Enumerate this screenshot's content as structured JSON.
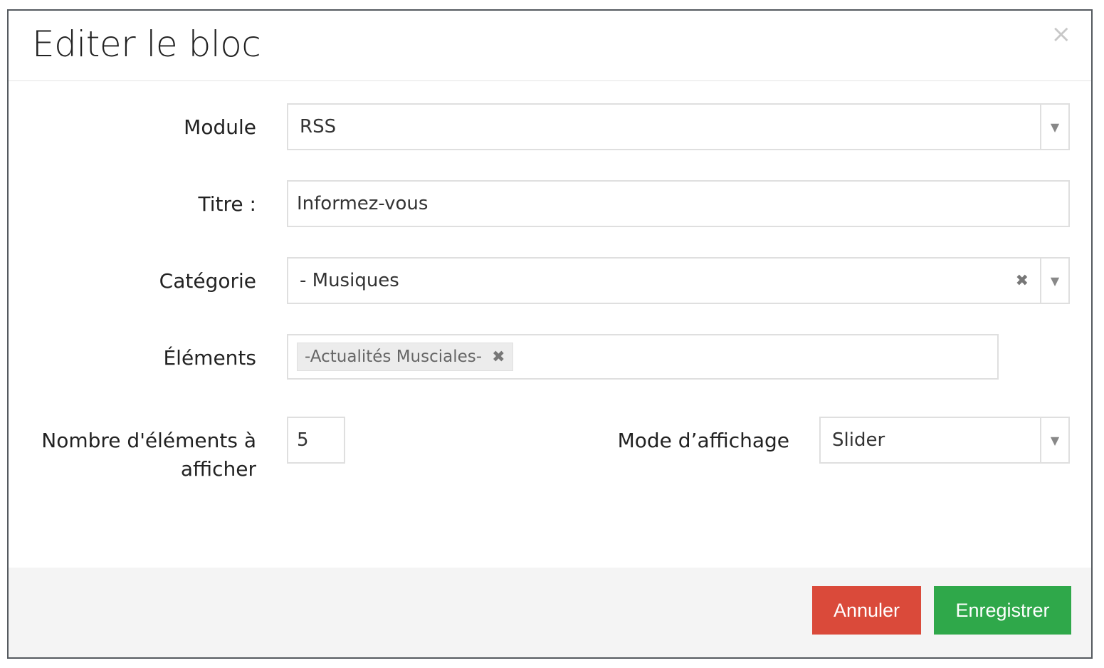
{
  "modal": {
    "title": "Editer le bloc",
    "close_symbol": "×"
  },
  "form": {
    "module": {
      "label": "Module",
      "value": "RSS"
    },
    "titre": {
      "label": "Titre :",
      "value": "Informez-vous"
    },
    "categorie": {
      "label": "Catégorie",
      "value": "- Musiques",
      "clear_symbol": "✖"
    },
    "elements": {
      "label": "Éléments",
      "tags": [
        "-Actualités Musciales-"
      ],
      "tag_remove_symbol": "✖"
    },
    "nombre": {
      "label_line1": "Nombre d'éléments à",
      "label_line2": "afficher",
      "value": "5"
    },
    "mode": {
      "label": "Mode d’affichage",
      "value": "Slider"
    },
    "dropdown_arrow": "▼"
  },
  "footer": {
    "cancel_label": "Annuler",
    "save_label": "Enregistrer"
  },
  "colors": {
    "cancel": "#da4a3a",
    "save": "#2fa84a",
    "footer_bg": "#f4f4f4"
  }
}
